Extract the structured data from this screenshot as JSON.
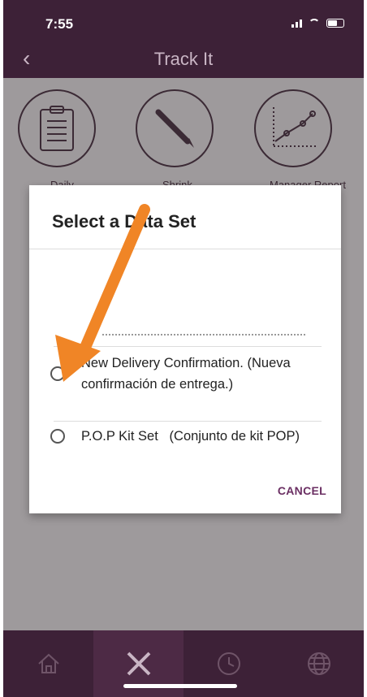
{
  "status": {
    "time": "7:55"
  },
  "header": {
    "back_icon": "chevron-left-icon",
    "title": "Track It"
  },
  "tiles": [
    {
      "icon": "clipboard-icon",
      "label": "Daily"
    },
    {
      "icon": "pencil-icon",
      "label": "Shrink"
    },
    {
      "icon": "line-chart-icon",
      "label": "Manager Report"
    }
  ],
  "dialog": {
    "title": "Select a Data Set",
    "options": [
      {
        "label": "New Delivery Confirmation. (Nueva confirmación de entrega.)"
      },
      {
        "label": "P.O.P Kit Set   (Conjunto de kit POP)"
      }
    ],
    "cancel_label": "CANCEL"
  },
  "tabs": [
    {
      "icon": "home-icon"
    },
    {
      "icon": "pencil-ruler-icon",
      "active": true
    },
    {
      "icon": "clock-icon"
    },
    {
      "icon": "globe-icon"
    }
  ],
  "colors": {
    "header": "#3d2137",
    "accent": "#6b2f63",
    "arrow": "#f08526"
  }
}
